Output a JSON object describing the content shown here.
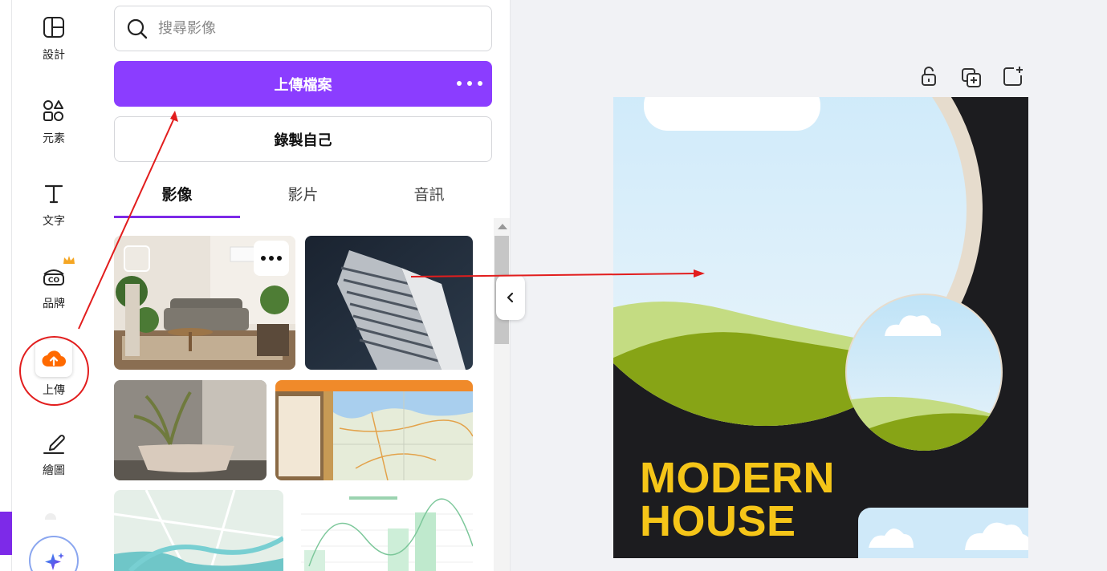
{
  "rail": {
    "items": [
      {
        "label": "設計",
        "icon": "design-layout-icon"
      },
      {
        "label": "元素",
        "icon": "elements-shapes-icon"
      },
      {
        "label": "文字",
        "icon": "text-t-icon"
      },
      {
        "label": "品牌",
        "icon": "brand-kit-icon"
      },
      {
        "label": "上傳",
        "icon": "cloud-upload-icon"
      },
      {
        "label": "繪圖",
        "icon": "draw-pen-icon"
      }
    ],
    "magic_icon": "sparkle-icon"
  },
  "panel": {
    "search_placeholder": "搜尋影像",
    "upload_button": "上傳檔案",
    "record_button": "錄製自己",
    "tabs": [
      "影像",
      "影片",
      "音訊"
    ],
    "active_tab": "影像"
  },
  "canvas": {
    "tools": [
      "lock-icon",
      "duplicate-page-icon",
      "add-page-icon"
    ],
    "poster_title_line1": "MODERN",
    "poster_title_line2": "HOUSE"
  },
  "colors": {
    "accent": "#8b3dff",
    "upload_icon": "#ff6a00",
    "annotation": "#e21d1d",
    "poster_title": "#f5c518"
  }
}
